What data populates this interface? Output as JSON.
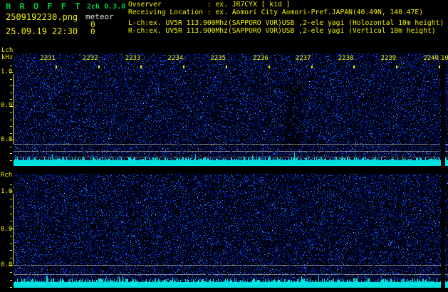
{
  "colors": {
    "accent_yellow": "#f2f200",
    "brand_green": "#00c840",
    "text_white": "#e6e6e6",
    "noise_blue": "#0000aa",
    "signal_cyan": "#00e2e2",
    "gridline_gray": "#969696",
    "background": "#000000"
  },
  "header": {
    "app_title": "H R O F F T",
    "version": "2ch 0.3.0",
    "filename": "2509192230.png",
    "datetime": "25.09.19 22:30",
    "meteor_label": "meteor",
    "meteor_count_lch": "0",
    "meteor_count_rch": "0",
    "observer_line": "Ovserver           : ex. JR7CYX [ kid ]",
    "location_line": "Receiving Location : ex. Aomori City Aomori-Pref.JAPAN(40.49N, 140.47E)",
    "lch_line": "L-ch:ex. UV5R 113.900Mhz(SAPPORO VOR)USB ,2-ele yagi (Holozontal 10m height)",
    "rch_line": "R-ch:ex. UV5R 113.900Mhz(SAPPORO VOR)USB ,2-ele yagi (Vertical 10m height)"
  },
  "lch_panel": {
    "label": "Lch",
    "unit": "kHz",
    "freq_ticks": [
      "1.0",
      "0.9",
      "0.8"
    ]
  },
  "rch_panel": {
    "label": "Rch",
    "freq_ticks": [
      "1.0",
      "0.9",
      "0.8"
    ]
  },
  "timeline": {
    "minute_labels": [
      "2231",
      "2232",
      "2233",
      "2234",
      "2235",
      "2236",
      "2237",
      "2238",
      "2239",
      "2240"
    ],
    "clipped_edge_label": "10"
  },
  "chart_data": {
    "type": "heatmap",
    "subtype": "dual-channel radio spectrogram (HROFFT meteor observation)",
    "title": "HROFFT 2ch 0.3.0 — 2509192230.png — 25.09.19 22:30",
    "x_axis": {
      "tick_labels": [
        "2231",
        "2232",
        "2233",
        "2234",
        "2235",
        "2236",
        "2237",
        "2238",
        "2239",
        "2240"
      ],
      "unit": "time (hhmm)",
      "window_start": "22:30",
      "window_end": "22:40"
    },
    "panels": [
      {
        "name": "Lch",
        "ylabel": "kHz",
        "y_tick_values": [
          1.0,
          0.9,
          0.8
        ],
        "carrier_lines_khz": [
          0.79,
          0.77,
          0.75
        ],
        "content": "blue background noise only, cyan noise-floor band at bottom",
        "meteor_count": 0
      },
      {
        "name": "Rch",
        "ylabel": "kHz",
        "y_tick_values": [
          1.0,
          0.9,
          0.8
        ],
        "carrier_lines_khz": [
          0.8,
          0.775
        ],
        "content": "blue background noise only, cyan noise-floor band at bottom",
        "meteor_count": 0
      }
    ],
    "legend": false,
    "grid": false
  }
}
